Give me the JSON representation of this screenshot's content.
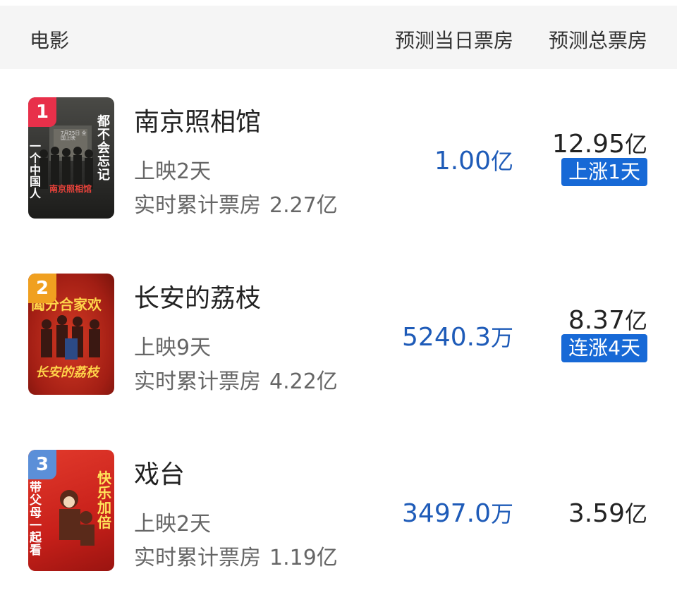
{
  "header": {
    "movie": "电影",
    "daily": "预测当日票房",
    "total": "预测总票房"
  },
  "movies": [
    {
      "rank": "1",
      "title": "南京照相馆",
      "days": "上映2天",
      "cum_label": "实时累计票房",
      "cum_value": "2.27亿",
      "daily_num": "1.00",
      "daily_unit": "亿",
      "total_num": "12.95",
      "total_unit": "亿",
      "badge": "上涨1天",
      "poster_text_a": "都不会忘记",
      "poster_text_b": "一个中国人",
      "poster_text_c": "南京照相馆",
      "poster_date": "7月25日 全国上映",
      "rank_color": "#e8304a",
      "poster_color": "#3a3a38"
    },
    {
      "rank": "2",
      "title": "长安的荔枝",
      "days": "上映9天",
      "cum_label": "实时累计票房",
      "cum_value": "4.22亿",
      "daily_num": "5240.3",
      "daily_unit": "万",
      "total_num": "8.37",
      "total_unit": "亿",
      "badge": "连涨4天",
      "poster_text_a": "阖分合家欢",
      "poster_text_b": "长安的荔枝",
      "rank_color": "#f0a020",
      "poster_color": "#b8261c"
    },
    {
      "rank": "3",
      "title": "戏台",
      "days": "上映2天",
      "cum_label": "实时累计票房",
      "cum_value": "1.19亿",
      "daily_num": "3497.0",
      "daily_unit": "万",
      "total_num": "3.59",
      "total_unit": "亿",
      "poster_text_a": "快乐加倍",
      "poster_text_b": "带父母一起看",
      "rank_color": "#5b8fd8",
      "poster_color": "#d42a22"
    }
  ]
}
